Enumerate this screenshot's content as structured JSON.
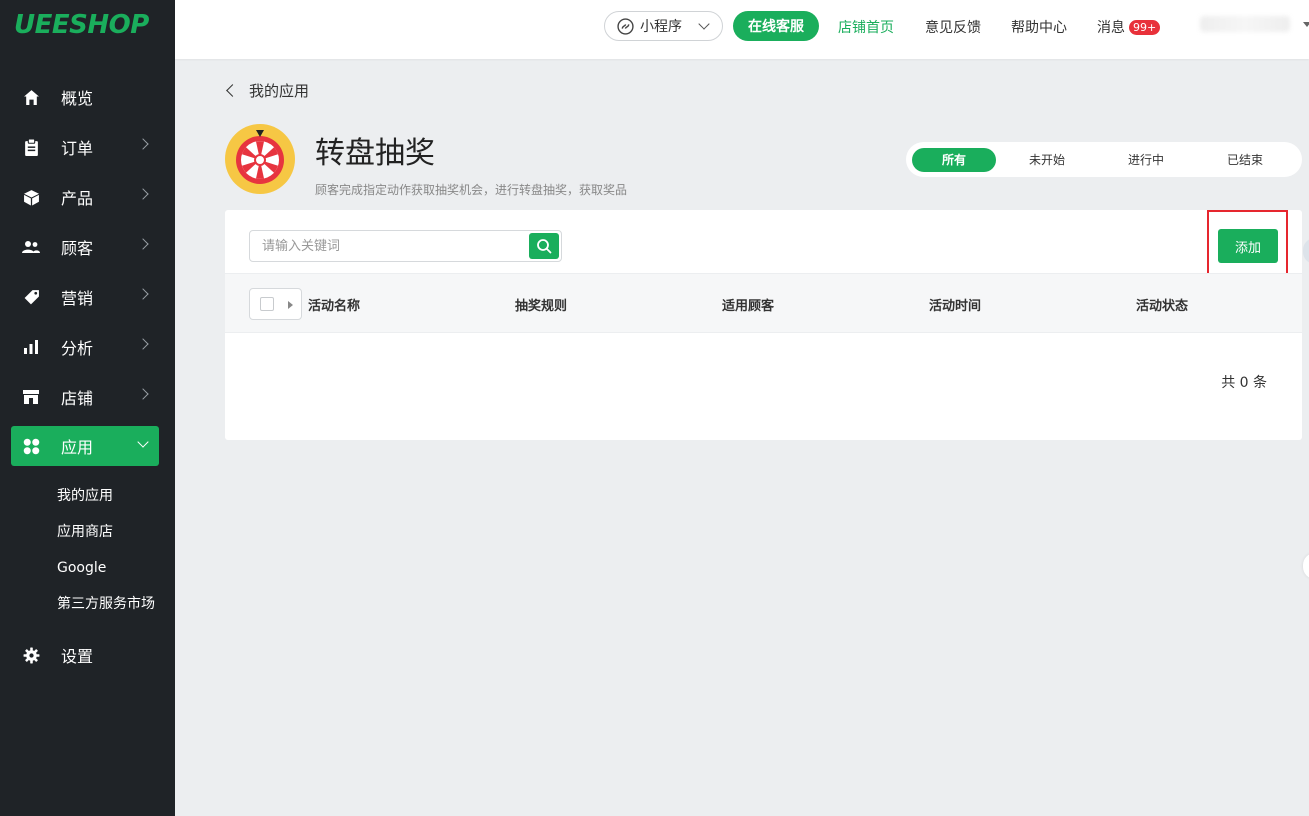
{
  "logo": "UEESHOP",
  "colors": {
    "accent": "#1aae5c",
    "sidebar_bg": "#1f2327",
    "badge": "#e8313a",
    "highlight": "#e6262e"
  },
  "sidebar": {
    "items": [
      {
        "label": "概览",
        "icon": "home-icon"
      },
      {
        "label": "订单",
        "icon": "clipboard-icon"
      },
      {
        "label": "产品",
        "icon": "box-icon"
      },
      {
        "label": "顾客",
        "icon": "users-icon"
      },
      {
        "label": "营销",
        "icon": "tag-icon"
      },
      {
        "label": "分析",
        "icon": "bar-chart-icon"
      },
      {
        "label": "店铺",
        "icon": "store-icon"
      },
      {
        "label": "应用",
        "icon": "apps-icon"
      },
      {
        "label": "设置",
        "icon": "gear-icon"
      }
    ],
    "submenu": [
      "我的应用",
      "应用商店",
      "Google",
      "第三方服务市场"
    ]
  },
  "header": {
    "mini_program": "小程序",
    "online_service": "在线客服",
    "store_home": "店铺首页",
    "feedback": "意见反馈",
    "help": "帮助中心",
    "messages": "消息",
    "badge": "99+"
  },
  "page": {
    "back": "我的应用",
    "title": "转盘抽奖",
    "description": "顾客完成指定动作获取抽奖机会，进行转盘抽奖，获取奖品"
  },
  "tabs": [
    "所有",
    "未开始",
    "进行中",
    "已结束"
  ],
  "search": {
    "placeholder": "请输入关键词"
  },
  "add_button": "添加",
  "table": {
    "headers": [
      "活动名称",
      "抽奖规则",
      "适用顾客",
      "活动时间",
      "活动状态"
    ],
    "total": "共 0 条"
  }
}
